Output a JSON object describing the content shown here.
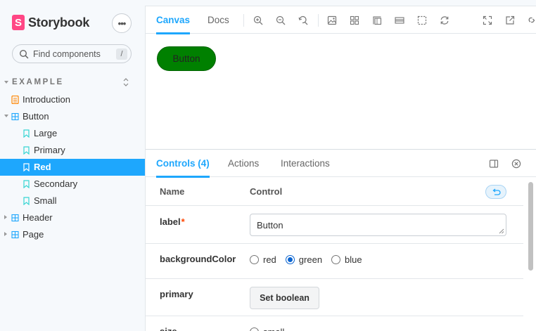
{
  "sidebar": {
    "brand": "Storybook",
    "brand_logo_letter": "S",
    "menu_icon": "ellipsis-icon",
    "search_placeholder": "Find components",
    "search_shortcut": "/",
    "section": "EXAMPLE",
    "items": [
      {
        "label": "Introduction",
        "icon": "document-icon"
      },
      {
        "label": "Button",
        "icon": "component-icon"
      },
      {
        "label": "Large",
        "icon": "bookmark-icon"
      },
      {
        "label": "Primary",
        "icon": "bookmark-icon"
      },
      {
        "label": "Red",
        "icon": "bookmark-icon",
        "selected": true
      },
      {
        "label": "Secondary",
        "icon": "bookmark-icon"
      },
      {
        "label": "Small",
        "icon": "bookmark-icon"
      },
      {
        "label": "Header",
        "icon": "component-icon"
      },
      {
        "label": "Page",
        "icon": "component-icon"
      }
    ]
  },
  "toolbar": {
    "tabs": [
      "Canvas",
      "Docs"
    ],
    "active_tab": "Canvas",
    "icons": [
      "zoom-in-icon",
      "zoom-out-icon",
      "zoom-reset-icon",
      "background-icon",
      "grid-icon",
      "measure-icon",
      "outline-icon",
      "viewport-icon",
      "remount-icon",
      "fullscreen-icon",
      "open-new-tab-icon",
      "copy-link-icon"
    ]
  },
  "canvas": {
    "button_label": "Button",
    "button_color": "#008000"
  },
  "addons": {
    "tabs": [
      "Controls (4)",
      "Actions",
      "Interactions"
    ],
    "active_tab": "Controls (4)",
    "header": {
      "name": "Name",
      "control": "Control"
    },
    "rows": {
      "label": {
        "name": "label",
        "required_mark": "*",
        "value": "Button"
      },
      "backgroundColor": {
        "name": "backgroundColor",
        "options": [
          "red",
          "green",
          "blue"
        ],
        "selected": "green"
      },
      "primary": {
        "name": "primary",
        "button": "Set boolean"
      },
      "size": {
        "name": "size",
        "first_option": "small"
      }
    }
  },
  "colors": {
    "accent": "#1ea7fd",
    "brand": "#ff4785",
    "required": "#ff4400"
  }
}
